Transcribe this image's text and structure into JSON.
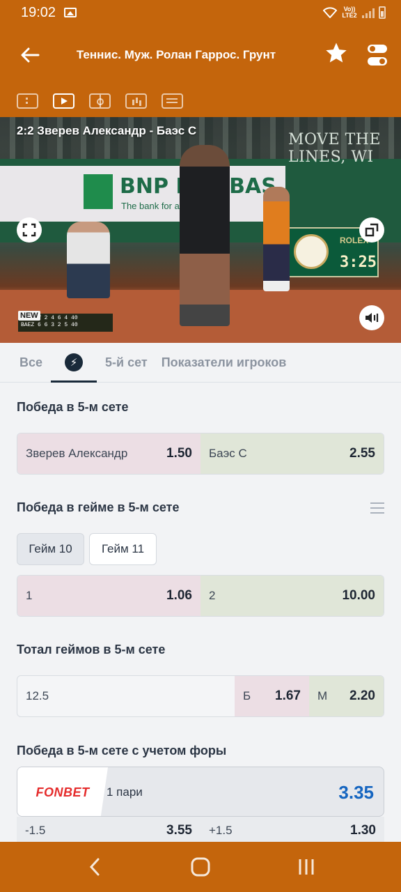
{
  "status_bar": {
    "time": "19:02",
    "network_label": "Vo)) LTE2"
  },
  "header": {
    "title": "Теннис. Муж. Ролан Гаррос. Грунт"
  },
  "video": {
    "match_title": "2:2  Зверев Александр - Баэс С",
    "sponsor_main": "BNP PARIBAS",
    "sponsor_sub": "The bank for a world",
    "wall_text": "MOVE THE LINES, WI",
    "clock_brand": "ROLEX",
    "clock_time": "3:25",
    "new_badge": "NEW",
    "scorebug_row1": "ZVEREV 2 4 6 4 40",
    "scorebug_row2": "BAEZ 6 6 3 2 5 40"
  },
  "tabs": {
    "all": "Все",
    "set5": "5-й сет",
    "player_stats": "Показатели игроков"
  },
  "markets": {
    "set_winner": {
      "title": "Победа в 5-м сете",
      "p1_name": "Зверев Александр",
      "p1_odd": "1.50",
      "p2_name": "Баэс С",
      "p2_odd": "2.55"
    },
    "game_winner": {
      "title": "Победа в гейме в 5-м сете",
      "chip1": "Гейм 10",
      "chip2": "Гейм 11",
      "p1_label": "1",
      "p1_odd": "1.06",
      "p2_label": "2",
      "p2_odd": "10.00"
    },
    "total_games": {
      "title": "Тотал геймов в 5-м сете",
      "line": "12.5",
      "over_label": "Б",
      "over_odd": "1.67",
      "under_label": "М",
      "under_odd": "2.20"
    },
    "handicap": {
      "title": "Победа в 5-м сете с учетом форы",
      "promo_brand": "FONBET",
      "promo_label": "1 пари",
      "promo_odd": "3.35",
      "h1_label": "-1.5",
      "h1_odd": "3.55",
      "h2_label": "+1.5",
      "h2_odd": "1.30"
    }
  },
  "colors": {
    "brand_orange": "#c4650c",
    "player1_bg": "#ecdee4",
    "player2_bg": "#e0e6d8",
    "promo_odd": "#1565c0"
  }
}
